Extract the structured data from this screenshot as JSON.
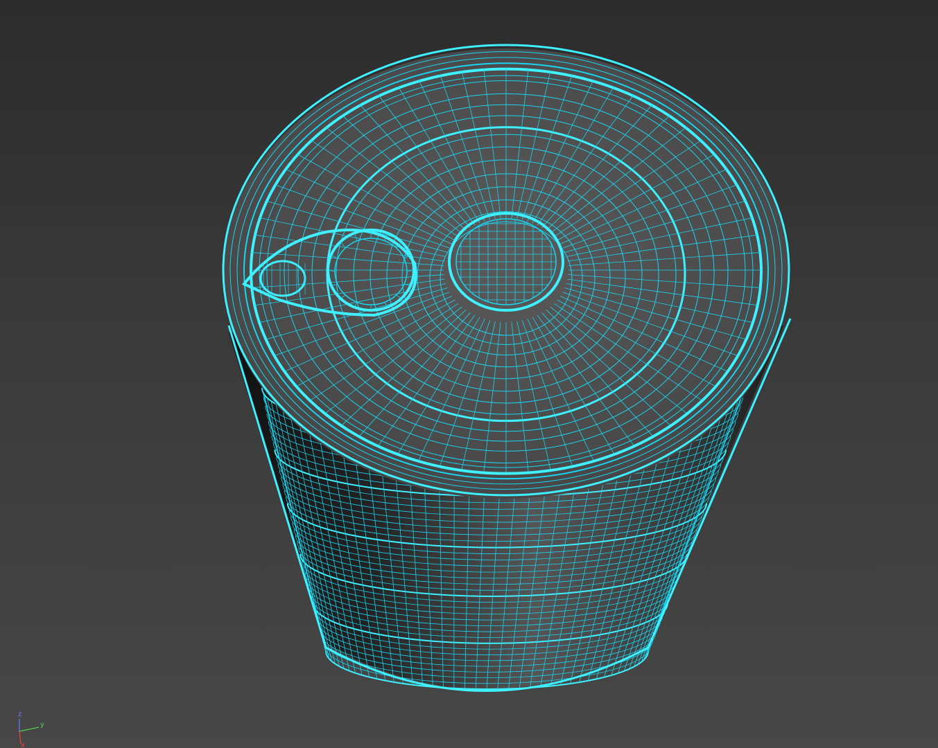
{
  "viewport": {
    "background_top": "#2c2c2c",
    "background_bottom": "#474747"
  },
  "model": {
    "wire_color": "#18d6f2",
    "wire_bright": "#3ff0ff",
    "shade_dark": "#1a1a1a",
    "shade_light": "#5a5a5a"
  },
  "axis_gizmo": {
    "z_label": "z",
    "y_label": "y",
    "x_label": "x",
    "z_color": "#6a7cff",
    "y_color": "#4fd24f",
    "x_color": "#ff3a3a"
  }
}
